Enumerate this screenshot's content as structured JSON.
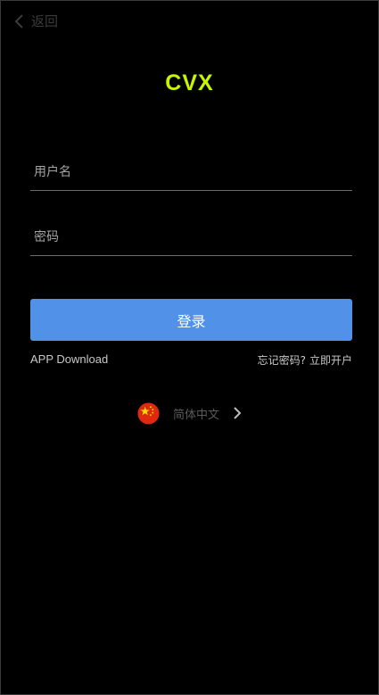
{
  "nav": {
    "back_label": "返回",
    "back_icon": "chevron-left-icon"
  },
  "brand": {
    "name": "CVX",
    "color": "#c9f400"
  },
  "form": {
    "username_placeholder": "用户名",
    "username_value": "",
    "password_placeholder": "密码",
    "password_value": "",
    "login_label": "登录",
    "login_color": "#5192e8"
  },
  "links": {
    "app_download": "APP Download",
    "forgot_password": "忘记密码?",
    "open_account": "立即开户"
  },
  "language": {
    "label": "简体中文",
    "flag_icon": "china-flag-icon",
    "arrow_icon": "chevron-right-icon"
  }
}
